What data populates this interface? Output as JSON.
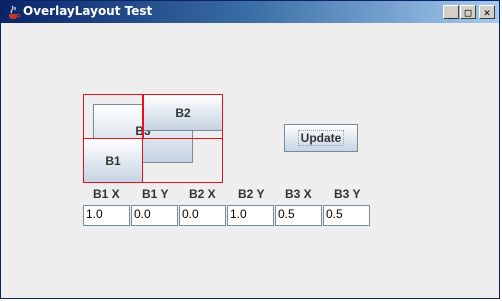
{
  "window": {
    "title": "OverlayLayout Test"
  },
  "titlebar_buttons": {
    "minimize": "_",
    "maximize": "□",
    "close": "✕"
  },
  "overlay": {
    "b3_label": "B3",
    "b2_label": "B2",
    "b1_label": "B1"
  },
  "update_button": {
    "label": "Update"
  },
  "columns": [
    "B1 X",
    "B1 Y",
    "B2 X",
    "B2 Y",
    "B3 X",
    "B3 Y"
  ],
  "fields": [
    "1.0",
    "0.0",
    "0.0",
    "1.0",
    "0.5",
    "0.5"
  ]
}
